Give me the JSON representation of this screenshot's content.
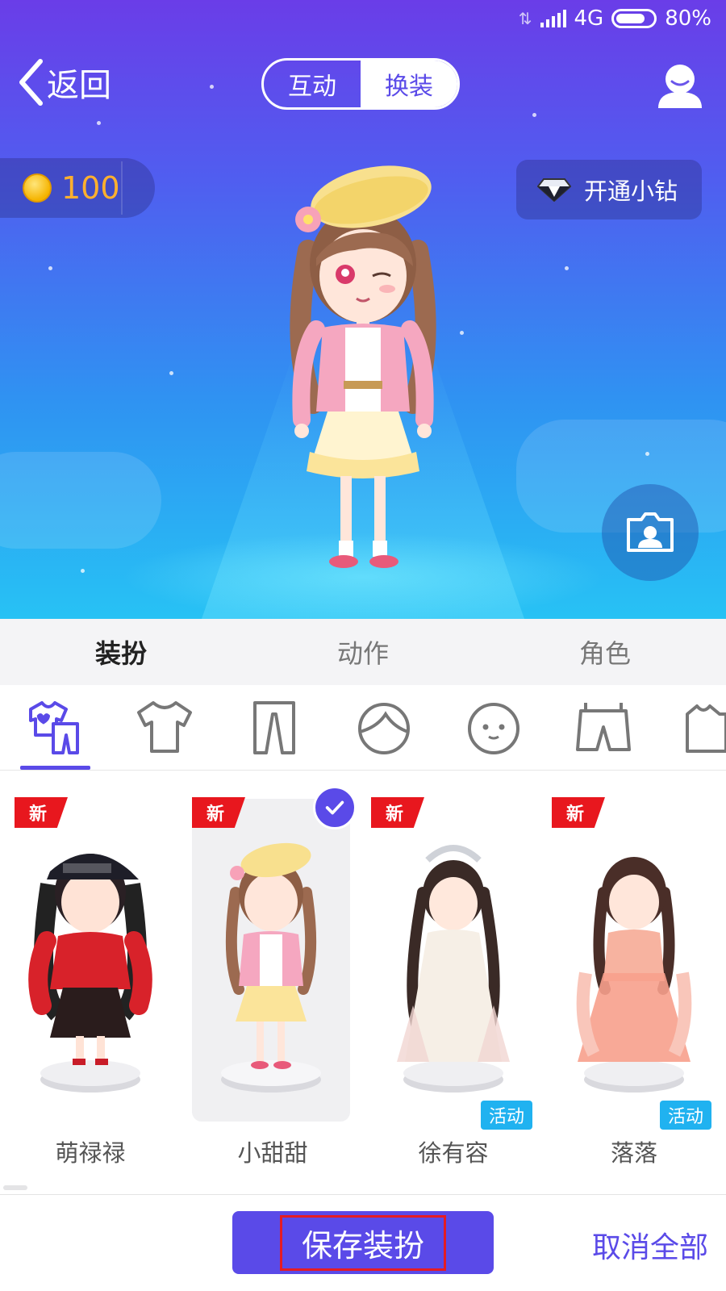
{
  "status_bar": {
    "network": "4G",
    "battery": "80%",
    "battery_level": 0.8
  },
  "nav": {
    "back_label": "返回",
    "tabs": [
      "互动",
      "换装"
    ],
    "active_tab": "换装"
  },
  "coins": {
    "value": "100"
  },
  "vip": {
    "label": "开通小钻"
  },
  "category_tabs": [
    {
      "label": "装扮",
      "active": true
    },
    {
      "label": "动作",
      "active": false
    },
    {
      "label": "角色",
      "active": false
    }
  ],
  "item_icons": [
    "outfit-set-icon",
    "shirt-icon",
    "pants-icon",
    "hair-icon",
    "face-icon",
    "shorts-icon",
    "more-clothing-icon"
  ],
  "outfits": [
    {
      "name": "萌禄禄",
      "badge": "新",
      "event_badge": "",
      "selected": false
    },
    {
      "name": "小甜甜",
      "badge": "新",
      "event_badge": "",
      "selected": true
    },
    {
      "name": "徐有容",
      "badge": "新",
      "event_badge": "活动",
      "selected": false
    },
    {
      "name": "落落",
      "badge": "新",
      "event_badge": "活动",
      "selected": false
    }
  ],
  "bottom": {
    "save_label": "保存装扮",
    "cancel_label": "取消全部"
  },
  "colors": {
    "accent": "#5a4ae8",
    "new_badge": "#e8171e",
    "event_badge": "#20b2f0",
    "coin": "#ffb02e"
  }
}
